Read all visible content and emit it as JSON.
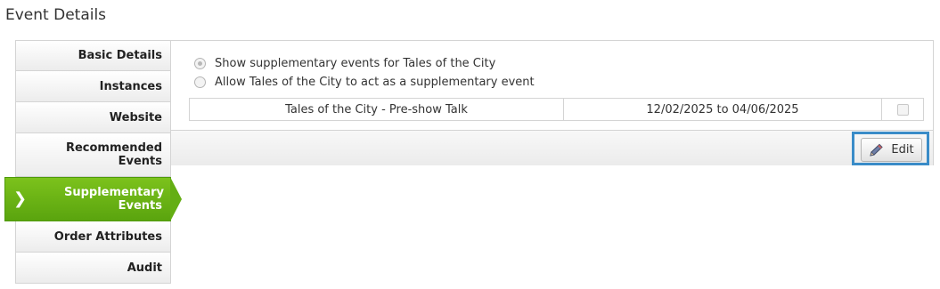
{
  "page": {
    "title": "Event Details"
  },
  "sidebar": {
    "items": [
      {
        "label": "Basic Details"
      },
      {
        "label": "Instances"
      },
      {
        "label": "Website"
      },
      {
        "label": "Recommended Events"
      },
      {
        "label": "Supplementary Events",
        "active": true
      },
      {
        "label": "Order Attributes"
      },
      {
        "label": "Audit"
      }
    ],
    "active_indicator": "❯"
  },
  "panel": {
    "options": [
      {
        "label": "Show supplementary events for Tales of the City",
        "selected": true
      },
      {
        "label": "Allow Tales of the City to act as a supplementary event",
        "selected": false
      }
    ],
    "rows": [
      {
        "name": "Tales of the City - Pre-show Talk",
        "dates": "12/02/2025 to 04/06/2025",
        "checked": false
      }
    ]
  },
  "toolbar": {
    "edit_label": "Edit",
    "edit_icon": "pencil-icon"
  },
  "colors": {
    "active_tab": "#6ab516",
    "highlight": "#3a8cc8"
  }
}
